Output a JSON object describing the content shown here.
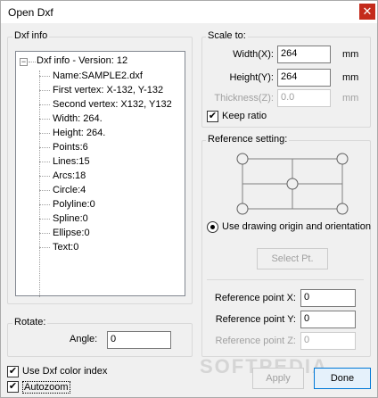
{
  "window": {
    "title": "Open Dxf",
    "close_glyph": "✕"
  },
  "dxf_info": {
    "group_label": "Dxf info",
    "root_label": "Dxf info - Version: 12",
    "expander_glyph": "−",
    "items": [
      "Name:SAMPLE2.dxf",
      "First vertex: X-132, Y-132",
      "Second vertex: X132, Y132",
      "Width: 264.",
      "Height: 264.",
      "Points:6",
      "Lines:15",
      "Arcs:18",
      "Circle:4",
      "Polyline:0",
      "Spline:0",
      "Ellipse:0",
      "Text:0"
    ]
  },
  "scale_to": {
    "group_label": "Scale to:",
    "width_label": "Width(X):",
    "width_value": "264",
    "width_unit": "mm",
    "height_label": "Height(Y):",
    "height_value": "264",
    "height_unit": "mm",
    "thickness_label": "Thickness(Z):",
    "thickness_value": "0.0",
    "thickness_unit": "mm",
    "keep_ratio_label": "Keep ratio",
    "keep_ratio_checked": true
  },
  "reference": {
    "group_label": "Reference setting:",
    "radio_label": "Use drawing origin and orientation",
    "select_button": "Select Pt.",
    "point_x_label": "Reference point X:",
    "point_x_value": "0",
    "point_y_label": "Reference point Y:",
    "point_y_value": "0",
    "point_z_label": "Reference point Z:",
    "point_z_value": "0"
  },
  "rotate": {
    "group_label": "Rotate:",
    "angle_label": "Angle:",
    "angle_value": "0"
  },
  "options": {
    "color_index_label": "Use Dxf color index",
    "autozoom_label": "Autozoom",
    "check_glyph": "✔"
  },
  "buttons": {
    "apply": "Apply",
    "done": "Done"
  },
  "watermark": "SOFTPEDIA"
}
